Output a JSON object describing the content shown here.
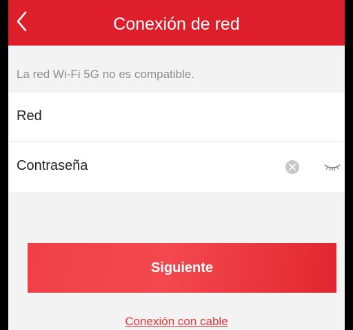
{
  "header": {
    "title": "Conexión de red",
    "back_icon": "chevron-left-icon"
  },
  "notice": {
    "text": "La red Wi-Fi 5G no es compatible."
  },
  "form": {
    "network_label": "Red",
    "network_value": "",
    "password_label": "Contraseña",
    "password_value": "",
    "clear_icon": "clear-circle-icon",
    "visibility_icon": "eye-closed-icon"
  },
  "actions": {
    "next_label": "Siguiente",
    "cable_link_label": "Conexión con cable"
  },
  "colors": {
    "brand_red": "#dd1f2b",
    "button_red": "#ef4048",
    "link_red": "#e8333b",
    "background": "#f3f3f3"
  }
}
